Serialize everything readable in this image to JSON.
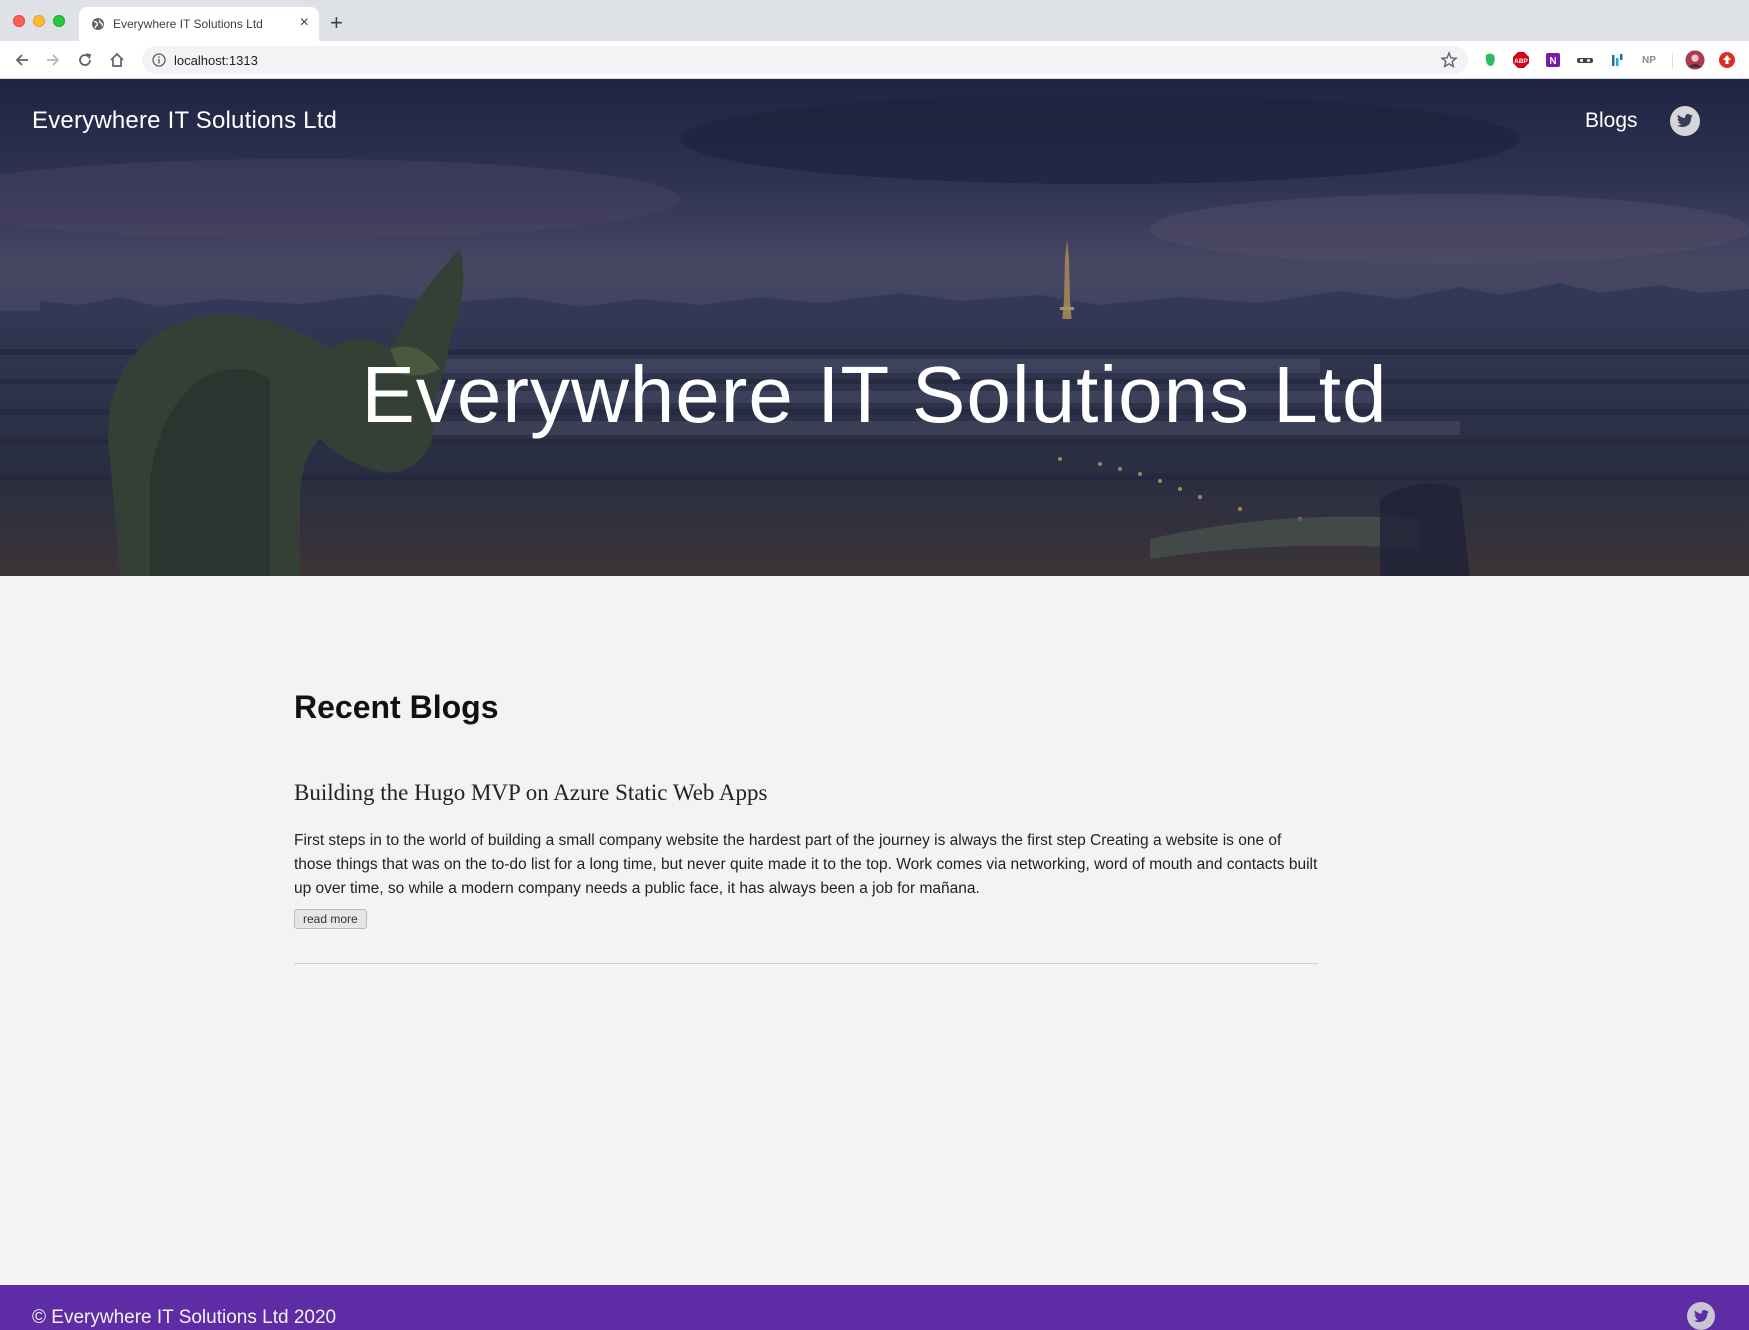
{
  "browser": {
    "tab_title": "Everywhere IT Solutions Ltd",
    "tab_close": "×",
    "new_tab": "+",
    "url": "localhost:1313",
    "extensions": [
      {
        "name": "evernote-icon",
        "label": "",
        "color": "#2dbe60"
      },
      {
        "name": "adblock-plus-icon",
        "label": "ABP",
        "color": "#d0021b"
      },
      {
        "name": "onenote-icon",
        "label": "N",
        "color": "#7719aa"
      },
      {
        "name": "incognito-mask-icon",
        "label": "",
        "color": "#555555"
      },
      {
        "name": "analytics-icon",
        "label": "",
        "color": "#1a73a8"
      },
      {
        "name": "np-icon",
        "label": "NP",
        "color": "#8a8a8a"
      }
    ]
  },
  "header": {
    "brand": "Everywhere IT Solutions Ltd",
    "nav_blogs": "Blogs",
    "twitter_icon": "twitter-icon"
  },
  "hero": {
    "title": "Everywhere IT Solutions Ltd"
  },
  "main": {
    "section_title": "Recent Blogs",
    "posts": [
      {
        "title": "Building the Hugo MVP on Azure Static Web Apps",
        "excerpt": "First steps in to the world of building a small company website the hardest part of the journey is always the first step Creating a website is one of those things that was on the to-do list for a long time, but never quite made it to the top. Work comes via networking, word of mouth and contacts built up over time, so while a modern company needs a public face, it has always been a job for mañana.",
        "read_more": "read more"
      }
    ]
  },
  "footer": {
    "copyright": "© Everywhere IT Solutions Ltd 2020"
  },
  "colors": {
    "footer_bg": "#5e2ca5",
    "page_bg": "#f3f3f3",
    "hero_overlay": "#2f3458"
  }
}
